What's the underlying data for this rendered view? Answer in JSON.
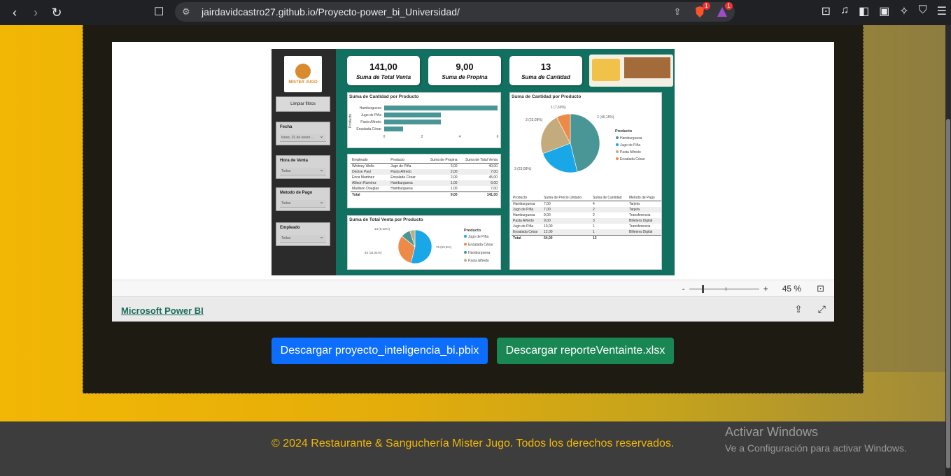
{
  "browser": {
    "url": "jairdavidcastro27.github.io/Proyecto-power_bi_Universidad/",
    "brave_badge": "1",
    "rewards_badge": "1"
  },
  "report": {
    "logo_text": "MISTER JUGO",
    "clear_filters": "Limpiar filtros",
    "filters": [
      {
        "label": "Fecha",
        "value": "lunes, 01 de enero ..."
      },
      {
        "label": "Hora de Venta",
        "value": "Todas"
      },
      {
        "label": "Metodo de Pago",
        "value": "Todas"
      },
      {
        "label": "Empleado",
        "value": "Todas"
      }
    ],
    "kpis": [
      {
        "value": "141,00",
        "label": "Suma de Total Venta"
      },
      {
        "value": "9,00",
        "label": "Suma de Propina"
      },
      {
        "value": "13",
        "label": "Suma de Cantidad"
      }
    ],
    "bar_card_title": "Suma de Cantidad por Producto",
    "bar_axis_label": "Producto",
    "pie_card_title": "Suma de Cantidad por Producto",
    "pie_legend_title": "Producto",
    "pie_labels": [
      "1 (7,69%)",
      "2 (46,15%)",
      "3 (23,08%)",
      "3 (23,08%)"
    ],
    "emp_table": {
      "headers": [
        "Empleado",
        "Producto",
        "Suma de Propina",
        "Suma de Total Venta"
      ],
      "rows": [
        [
          "Whitney Wells",
          "Jugo de Piña",
          "3,00",
          "40,00"
        ],
        [
          "Denise Paul",
          "Pasta Alfredo",
          "2,00",
          "7,00"
        ],
        [
          "Erica Martinez",
          "Ensalada César",
          "2,00",
          "45,00"
        ],
        [
          "Allison Ramirez",
          "Hamburguesa",
          "1,00",
          "6,00"
        ],
        [
          "Madison Douglas",
          "Hamburguesa",
          "1,00",
          "7,00"
        ]
      ],
      "total": [
        "Total",
        "",
        "9,00",
        "141,00"
      ]
    },
    "sales_pie_title": "Suma de Total Venta por Producto",
    "sales_pie_labels": [
      "13 (9,22%)",
      "45 (31,91%)",
      "76 (53,9%)"
    ],
    "sales_legend_title": "Producto",
    "sales_legend": [
      "Jugo de Piña",
      "Ensalada César",
      "Hamburguesa",
      "Pasta Alfredo"
    ],
    "prod_table": {
      "headers": [
        "Producto",
        "Suma de Precio Unitario",
        "Suma de Cantidad",
        "Metodo de Pago"
      ],
      "rows": [
        [
          "Hamburguesa",
          "7,00",
          "4",
          "Tarjeta"
        ],
        [
          "Jugo de Piña",
          "7,00",
          "2",
          "Tarjeta"
        ],
        [
          "Hamburguesa",
          "9,00",
          "2",
          "Transferencia"
        ],
        [
          "Pasta Alfredo",
          "9,00",
          "3",
          "Billetera Digital"
        ],
        [
          "Jugo de Piña",
          "10,00",
          "1",
          "Transferencia"
        ],
        [
          "Ensalada César",
          "12,00",
          "1",
          "Billetera Digital"
        ]
      ],
      "total": [
        "Total",
        "54,00",
        "13",
        ""
      ]
    },
    "colors": {
      "teal": "#4a9696",
      "blue": "#1aa7e8",
      "tan": "#c4ab7b",
      "orange": "#ee8a48"
    }
  },
  "chart_data": [
    {
      "type": "bar",
      "title": "Suma de Cantidad por Producto",
      "ylabel": "Producto",
      "categories": [
        "Hamburguesa",
        "Jugo de Piña",
        "Pasta Alfredo",
        "Ensalada César"
      ],
      "values": [
        6,
        3,
        3,
        1
      ],
      "xlim": [
        0,
        6
      ],
      "xticks": [
        "0",
        "2",
        "4",
        "6"
      ]
    },
    {
      "type": "pie",
      "title": "Suma de Cantidad por Producto",
      "categories": [
        "Hamburguesa",
        "Jugo de Piña",
        "Pasta Alfredo",
        "Ensalada César"
      ],
      "values": [
        6,
        3,
        3,
        1
      ]
    },
    {
      "type": "pie",
      "title": "Suma de Total Venta por Producto",
      "categories": [
        "Jugo de Piña",
        "Ensalada César",
        "Hamburguesa",
        "Pasta Alfredo"
      ],
      "values": [
        76,
        45,
        13,
        7
      ]
    }
  ],
  "embed": {
    "zoom_minus": "-",
    "zoom_plus": "+",
    "zoom_level": "45 %",
    "powerbi_link": "Microsoft Power BI"
  },
  "buttons": {
    "download_pbix": "Descargar proyecto_inteligencia_bi.pbix",
    "download_xlsx": "Descargar reporteVentainte.xlsx"
  },
  "footer": {
    "copyright": "© 2024 Restaurante & Sanguchería Mister Jugo. Todos los derechos reservados."
  },
  "windows": {
    "line1": "Activar Windows",
    "line2": "Ve a Configuración para activar Windows."
  }
}
